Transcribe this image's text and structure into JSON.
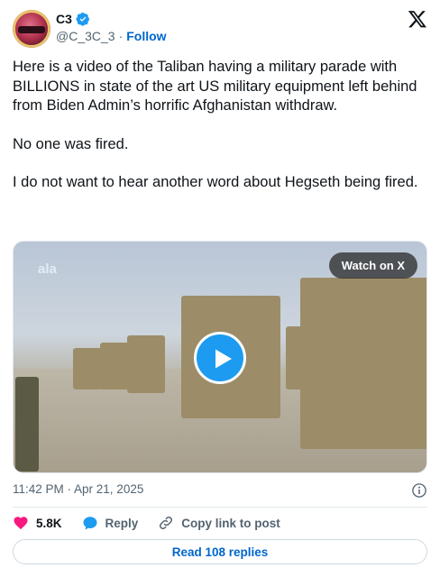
{
  "author": {
    "name": "C3",
    "handle": "@C_3C_3",
    "separator": "·",
    "follow_label": "Follow"
  },
  "tweet": {
    "paragraphs": [
      "Here is a video of the Taliban having a military parade with BILLIONS in state of the art US military equipment left behind from Biden Admin’s horrific Afghanistan withdraw.",
      "No one was fired.",
      "I do not want to hear another word about Hegseth being fired."
    ]
  },
  "media": {
    "watch_label": "Watch on X",
    "watermark": "ala"
  },
  "meta": {
    "timestamp": "11:42 PM · Apr 21, 2025"
  },
  "actions": {
    "like_count": "5.8K",
    "reply_label": "Reply",
    "copy_label": "Copy link to post"
  },
  "footer": {
    "read_replies_label": "Read 108 replies"
  },
  "colors": {
    "link": "#0066cc",
    "verified": "#1d9bf0",
    "like": "#f91880",
    "reply": "#1d9bf0",
    "play": "#1d9bf0"
  }
}
